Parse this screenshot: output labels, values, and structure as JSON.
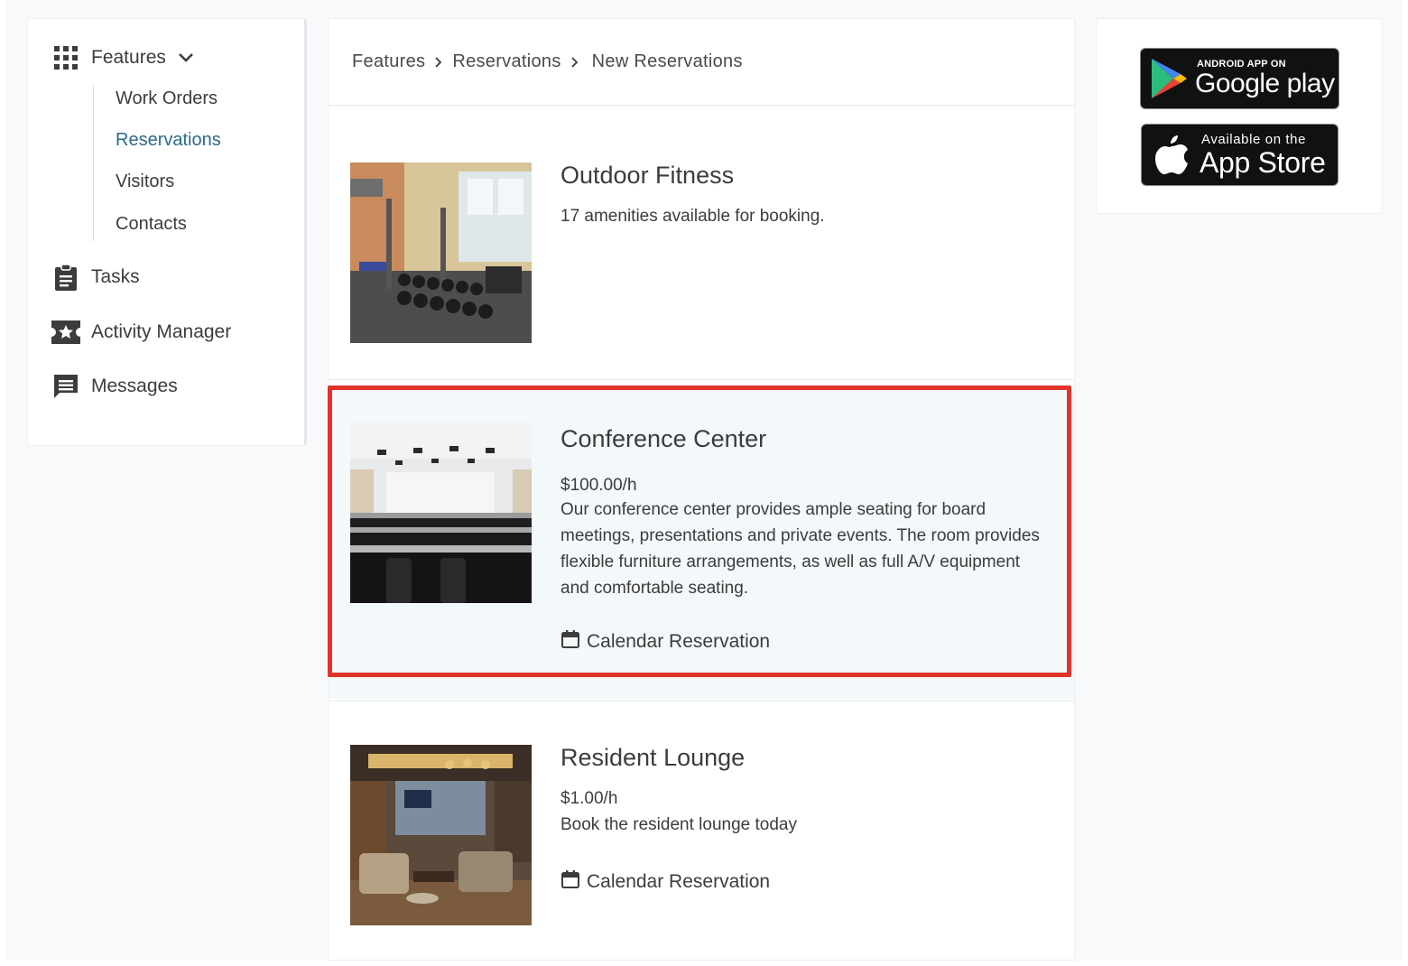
{
  "sidebar": {
    "features_label": "Features",
    "sub_items": [
      "Work Orders",
      "Reservations",
      "Visitors",
      "Contacts"
    ],
    "active_sub_item": "Reservations",
    "items": [
      {
        "label": "Tasks",
        "icon": "clipboard-icon"
      },
      {
        "label": "Activity Manager",
        "icon": "star-ticket-icon"
      },
      {
        "label": "Messages",
        "icon": "message-icon"
      }
    ]
  },
  "breadcrumb": [
    "Features",
    "Reservations",
    "New Reservations"
  ],
  "cards": [
    {
      "title": "Outdoor Fitness",
      "subtitle": "17 amenities available for booking.",
      "image": "gym-photo"
    },
    {
      "title": "Conference Center",
      "price": "$100.00/h",
      "description": "Our conference center provides ample seating for board meetings, presentations and private events. The room provides flexible furniture arrangements, as well as full A/V equipment and comfortable seating.",
      "action": "Calendar Reservation",
      "image": "conference-room-photo",
      "selected": true
    },
    {
      "title": "Resident Lounge",
      "price": "$1.00/h",
      "description": "Book the resident lounge today",
      "action": "Calendar Reservation",
      "image": "lounge-photo"
    }
  ],
  "stores": {
    "google": {
      "small": "ANDROID APP ON",
      "big": "Google play"
    },
    "apple": {
      "small": "Available on the",
      "big": "App Store"
    }
  },
  "colors": {
    "active_link": "#2a6a8a",
    "highlight_border": "#e0332a",
    "selected_card_bg": "#f3f8fb"
  }
}
